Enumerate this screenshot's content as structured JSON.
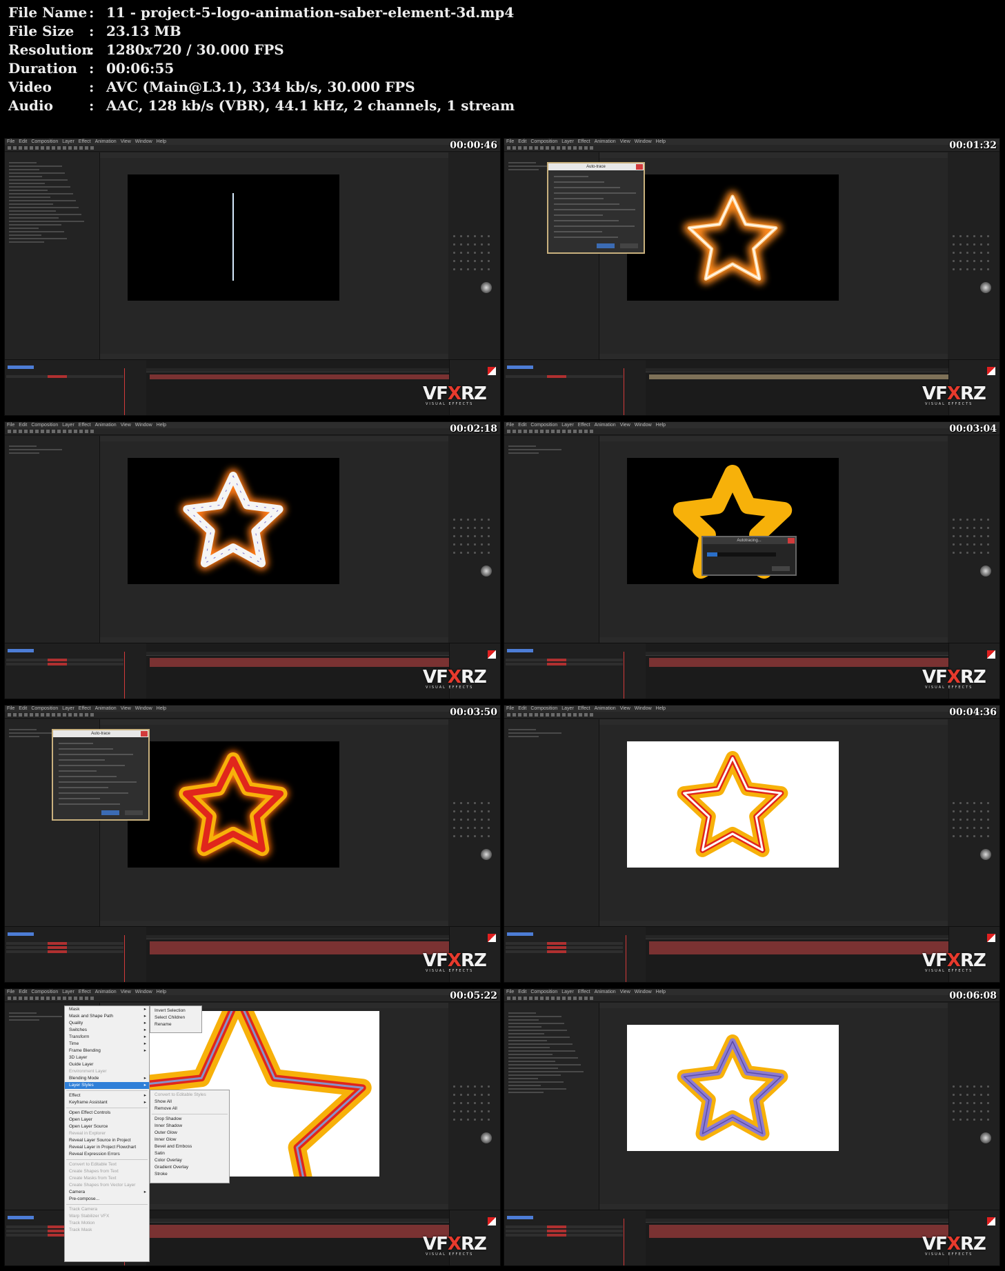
{
  "info": {
    "rows": [
      {
        "key": "File Name",
        "sep": ":",
        "value": "11 - project-5-logo-animation-saber-element-3d.mp4"
      },
      {
        "key": "File Size",
        "sep": ":",
        "value": "23.13 MB"
      },
      {
        "key": "Resolution",
        "sep": ":",
        "value": "1280x720 / 30.000 FPS"
      },
      {
        "key": "Duration",
        "sep": ":",
        "value": "00:06:55"
      },
      {
        "key": "Video",
        "sep": ":",
        "value": "AVC (Main@L3.1), 334 kb/s, 30.000 FPS"
      },
      {
        "key": "Audio",
        "sep": ":",
        "value": "AAC, 128 kb/s (VBR), 44.1 kHz, 2 channels, 1 stream"
      }
    ]
  },
  "app": {
    "menu": [
      "File",
      "Edit",
      "Composition",
      "Layer",
      "Effect",
      "Animation",
      "View",
      "Window",
      "Help"
    ]
  },
  "watermark": {
    "text_a": "VF",
    "text_x": "X",
    "text_b": "RZ",
    "sub": "VISUAL EFFECTS"
  },
  "thumbs": [
    {
      "time": "00:00:46",
      "scene": "saber-line"
    },
    {
      "time": "00:01:32",
      "scene": "fire-star-dialog"
    },
    {
      "time": "00:02:18",
      "scene": "white-star"
    },
    {
      "time": "00:03:04",
      "scene": "autotracing"
    },
    {
      "time": "00:03:50",
      "scene": "red-star-dialog"
    },
    {
      "time": "00:04:36",
      "scene": "star-white-bg"
    },
    {
      "time": "00:05:22",
      "scene": "context-menu"
    },
    {
      "time": "00:06:08",
      "scene": "purple-star"
    }
  ],
  "dialogs": {
    "autotrace": {
      "title": "Auto-trace"
    },
    "autotracing": {
      "title": "Autotracing...",
      "progress": 0.15
    }
  },
  "context_menu": {
    "items": [
      {
        "label": "Mask",
        "sub": true
      },
      {
        "label": "Mask and Shape Path",
        "sub": true
      },
      {
        "label": "Quality",
        "sub": true
      },
      {
        "label": "Switches",
        "sub": true
      },
      {
        "label": "Transform",
        "sub": true
      },
      {
        "label": "Time",
        "sub": true
      },
      {
        "label": "Frame Blending",
        "sub": true
      },
      {
        "label": "3D Layer"
      },
      {
        "label": "Guide Layer"
      },
      {
        "label": "Environment Layer",
        "disabled": true
      },
      {
        "label": "Blending Mode",
        "sub": true
      },
      {
        "label": "Layer Styles",
        "sub": true,
        "highlighted": true
      },
      {
        "sep": true
      },
      {
        "label": "Effect",
        "sub": true
      },
      {
        "label": "Keyframe Assistant",
        "sub": true
      },
      {
        "sep": true
      },
      {
        "label": "Open Effect Controls"
      },
      {
        "label": "Open Layer"
      },
      {
        "label": "Open Layer Source"
      },
      {
        "label": "Reveal in Explorer",
        "disabled": true
      },
      {
        "label": "Reveal Layer Source in Project"
      },
      {
        "label": "Reveal Layer in Project Flowchart"
      },
      {
        "label": "Reveal Expression Errors"
      },
      {
        "sep": true
      },
      {
        "label": "Convert to Editable Text",
        "disabled": true
      },
      {
        "label": "Create Shapes from Text",
        "disabled": true
      },
      {
        "label": "Create Masks from Text",
        "disabled": true
      },
      {
        "label": "Create Shapes from Vector Layer",
        "disabled": true
      },
      {
        "label": "Camera",
        "sub": true
      },
      {
        "label": "Pre-compose..."
      },
      {
        "sep": true
      },
      {
        "label": "Track Camera",
        "disabled": true
      },
      {
        "label": "Warp Stabilizer VFX",
        "disabled": true
      },
      {
        "label": "Track Motion",
        "disabled": true
      },
      {
        "label": "Track Mask",
        "disabled": true
      }
    ],
    "top_submenu": [
      "Invert Selection",
      "Select Children",
      "Rename"
    ],
    "styles_submenu": [
      {
        "label": "Convert to Editable Styles",
        "disabled": true
      },
      {
        "label": "Show All"
      },
      {
        "label": "Remove All"
      },
      {
        "sep": true
      },
      {
        "label": "Drop Shadow"
      },
      {
        "label": "Inner Shadow"
      },
      {
        "label": "Outer Glow"
      },
      {
        "label": "Inner Glow"
      },
      {
        "label": "Bevel and Emboss"
      },
      {
        "label": "Satin"
      },
      {
        "label": "Color Overlay"
      },
      {
        "label": "Gradient Overlay"
      },
      {
        "label": "Stroke"
      }
    ]
  },
  "colors": {
    "saber_blue": "#2a8cff",
    "fire_orange": "#ff8a1a",
    "star_yellow": "#f7b10a",
    "star_red": "#e0261c",
    "star_purple": "#8d7bd0",
    "brand_red": "#e83a2d",
    "dialog_border": "#c9b17e"
  }
}
